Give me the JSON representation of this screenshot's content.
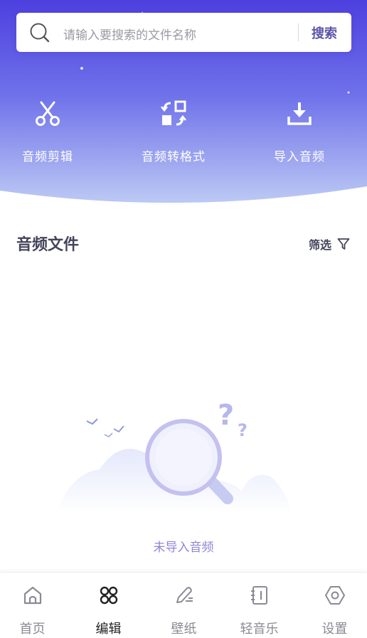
{
  "search": {
    "placeholder": "请输入要搜索的文件名称",
    "button_label": "搜索"
  },
  "actions": [
    {
      "label": "音频剪辑",
      "icon": "scissors-icon"
    },
    {
      "label": "音频转格式",
      "icon": "convert-format-icon"
    },
    {
      "label": "导入音频",
      "icon": "import-download-icon"
    }
  ],
  "section": {
    "title": "音频文件",
    "filter_label": "筛选"
  },
  "empty_state": {
    "message": "未导入音频"
  },
  "tabbar": {
    "items": [
      {
        "label": "首页",
        "icon": "home-icon",
        "active": false
      },
      {
        "label": "编辑",
        "icon": "edit-grid-icon",
        "active": true
      },
      {
        "label": "壁纸",
        "icon": "pencil-icon",
        "active": false
      },
      {
        "label": "轻音乐",
        "icon": "music-notebook-icon",
        "active": false
      },
      {
        "label": "设置",
        "icon": "settings-hexagon-icon",
        "active": false
      }
    ]
  },
  "colors": {
    "hero_top": "#4f43e0",
    "hero_bottom": "#bfcdf3",
    "accent_text": "#5b54a8",
    "empty_text": "#8f86d6"
  }
}
